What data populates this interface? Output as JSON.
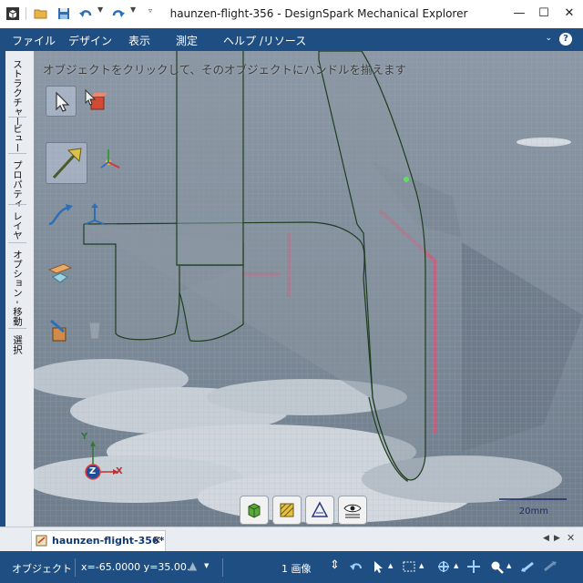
{
  "window": {
    "title": "haunzen-flight-356 - DesignSpark Mechanical Explorer",
    "minimize": "—",
    "maximize": "☐",
    "close": "✕"
  },
  "menu": {
    "items": [
      "ファイル",
      "デザイン",
      "表示",
      "測定",
      "ヘルプ /リソース"
    ],
    "help": "?"
  },
  "left_rail": {
    "tabs": [
      "ストラクチャー",
      "ビュー",
      "プロパティ",
      "レイヤ",
      "オプション - 移動",
      "選択"
    ]
  },
  "viewport": {
    "hint": "オブジェクトをクリックして、そのオブジェクトにハンドルを揃えます",
    "scale_label": "20mm",
    "triad": {
      "x": "X",
      "y": "Y",
      "z": "Z"
    },
    "colors": {
      "outline": "#1f3d1f",
      "highlight": "#d9547a",
      "accent": "#2f7a2f"
    }
  },
  "document": {
    "tab_label": "haunzen-flight-356*",
    "tab_close": "✕"
  },
  "status": {
    "object": "オブジェクト",
    "coords": "x=-65.0000  y=35.00...",
    "selection": "1 画像"
  }
}
